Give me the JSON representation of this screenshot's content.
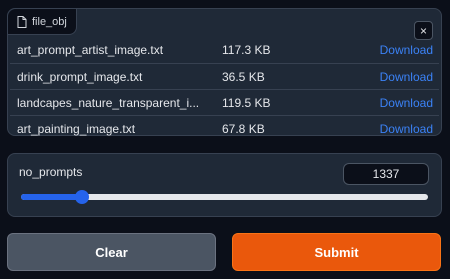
{
  "file_component": {
    "label": "file_obj",
    "close_symbol": "×",
    "icon": "file-icon",
    "files": [
      {
        "name": "art_prompt_artist_image.txt",
        "size": "117.3 KB",
        "action": "Download"
      },
      {
        "name": "drink_prompt_image.txt",
        "size": "36.5 KB",
        "action": "Download"
      },
      {
        "name": "landcapes_nature_transparent_i...",
        "size": "119.5 KB",
        "action": "Download"
      },
      {
        "name": "art_painting_image.txt",
        "size": "67.8 KB",
        "action": "Download"
      }
    ]
  },
  "slider": {
    "label": "no_prompts",
    "value": "1337",
    "fill_fraction": 0.15
  },
  "buttons": {
    "clear_label": "Clear",
    "submit_label": "Submit"
  },
  "colors": {
    "accent": "#2563eb",
    "submit": "#ea580c",
    "link": "#3b82f6"
  }
}
